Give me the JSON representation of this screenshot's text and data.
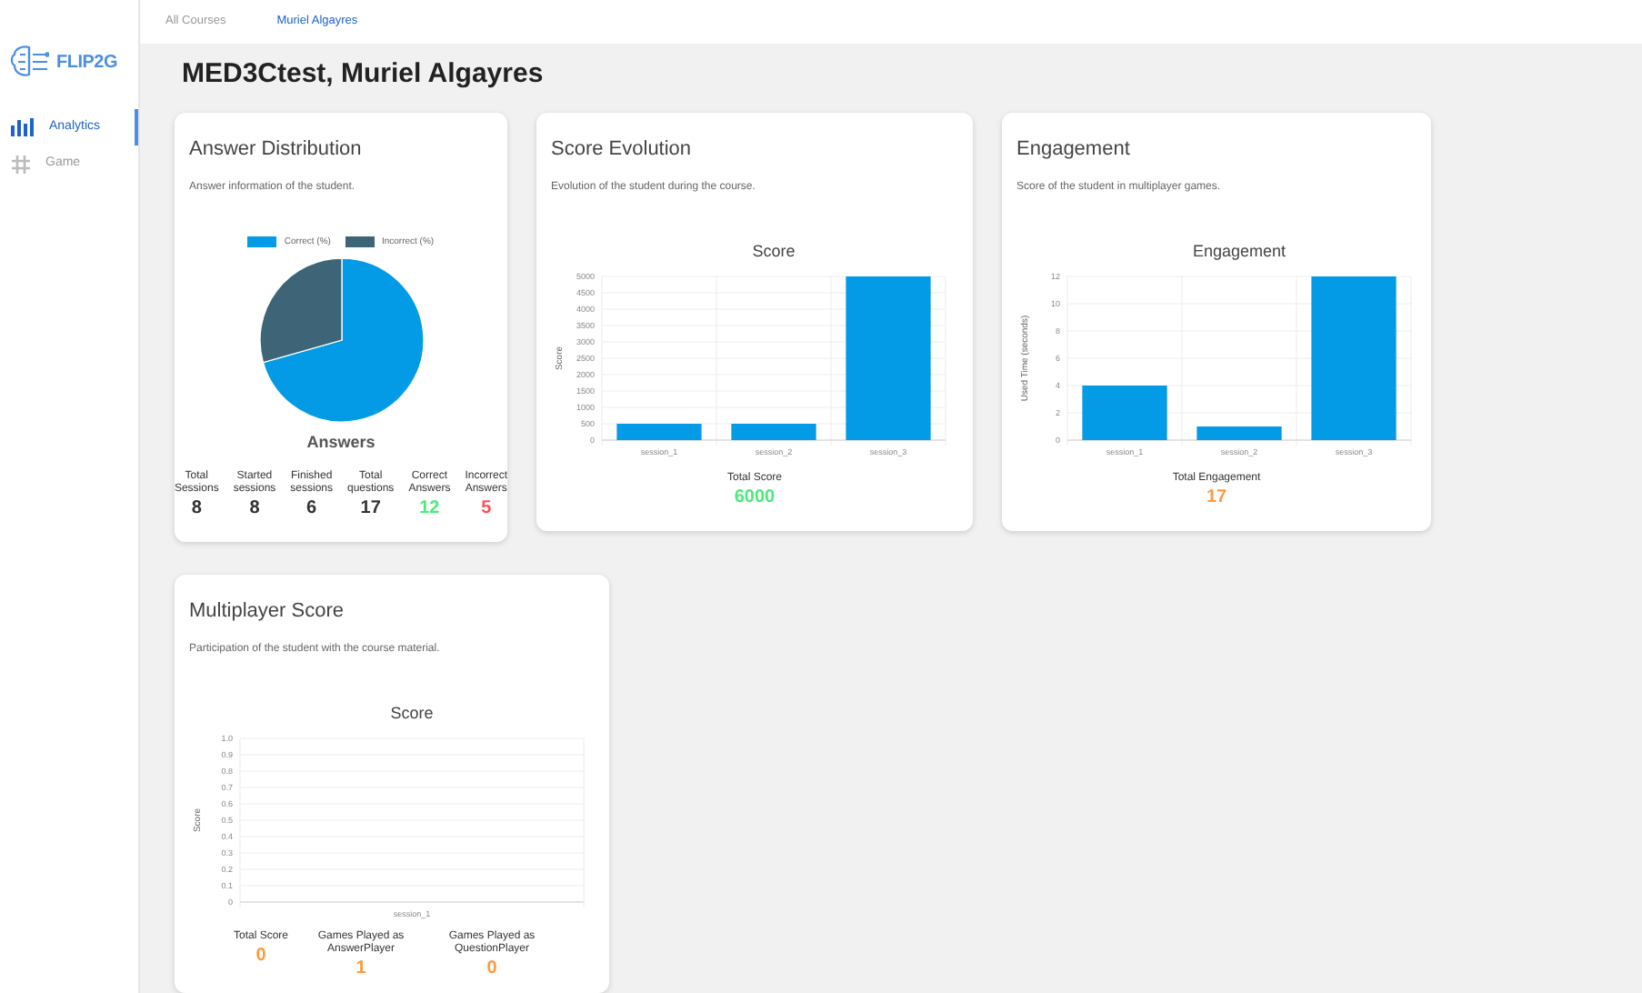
{
  "sidebar": {
    "logo": "FLIP2G",
    "items": [
      {
        "label": "Analytics",
        "kind": "analytics",
        "selected": true
      },
      {
        "label": "Game",
        "kind": "game",
        "selected": false
      }
    ]
  },
  "breadcrumbs": [
    {
      "label": "All Courses",
      "selected": false
    },
    {
      "label": "Muriel Algayres",
      "selected": true
    }
  ],
  "page_title": "MED3Ctest, Muriel Algayres",
  "cards": [
    {
      "title": "Answer Distribution",
      "subtitle": "Answer information of the student.",
      "chart_data": {
        "type": "pie",
        "title": "Answers",
        "categories": [
          "Correct (%)",
          "Incorrect (%)"
        ],
        "values": [
          70.59,
          29.41
        ],
        "colors": [
          "#039be5",
          "#3d6577"
        ],
        "legend": "top"
      },
      "stats": [
        {
          "label": "Total Sessions",
          "value": "8",
          "color": "#333333"
        },
        {
          "label": "Started sessions",
          "value": "8",
          "color": "#333333"
        },
        {
          "label": "Finished sessions",
          "value": "6",
          "color": "#333333"
        },
        {
          "label": "Total questions",
          "value": "17",
          "color": "#333333"
        },
        {
          "label": "Correct Answers",
          "value": "12",
          "color": "#4cea7c"
        },
        {
          "label": "Incorrect Answers",
          "value": "5",
          "color": "#ff5252"
        }
      ]
    },
    {
      "title": "Score Evolution",
      "subtitle": "Evolution of the student during the course.",
      "chart_data": {
        "type": "bar",
        "title": "Score",
        "ylabel": "Score",
        "categories": [
          "session_1",
          "session_2",
          "session_3"
        ],
        "values": [
          500,
          500,
          5000
        ],
        "color": "#039be5",
        "grid": true,
        "ylim": [
          0,
          5000
        ],
        "yticks": [
          0,
          500,
          1000,
          1500,
          2000,
          2500,
          3000,
          3500,
          4000,
          4500,
          5000
        ]
      },
      "stats": [
        {
          "label": "Total Score",
          "value": "6000",
          "color": "#4cea7c"
        }
      ]
    },
    {
      "title": "Engagement",
      "subtitle": "Score of the student in multiplayer games.",
      "chart_data": {
        "type": "bar",
        "title": "Engagement",
        "ylabel": "Used Time (seconds)",
        "categories": [
          "session_1",
          "session_2",
          "session_3"
        ],
        "values": [
          4,
          1,
          12
        ],
        "color": "#039be5",
        "grid": true,
        "ylim": [
          0,
          12
        ],
        "yticks": [
          0,
          2,
          4,
          6,
          8,
          10,
          12
        ]
      },
      "stats": [
        {
          "label": "Total Engagement",
          "value": "17",
          "color": "#ff9a3c"
        }
      ]
    },
    {
      "title": "Multiplayer Score",
      "subtitle": "Participation of the student with the course material.",
      "chart_data": {
        "type": "bar",
        "title": "Score",
        "ylabel": "Score",
        "categories": [
          "session_1"
        ],
        "values": [
          0
        ],
        "grid": true,
        "ylim": [
          0,
          1
        ],
        "yticks": [
          0,
          {
            "value": 0.1,
            "label": "0.1"
          },
          {
            "value": 0.2,
            "label": "0.2"
          },
          {
            "value": 0.3,
            "label": "0.3"
          },
          {
            "value": 0.4,
            "label": "0.4"
          },
          {
            "value": 0.5,
            "label": "0.5"
          },
          {
            "value": 0.6,
            "label": "0.6"
          },
          {
            "value": 0.7,
            "label": "0.7"
          },
          {
            "value": 0.8,
            "label": "0.8"
          },
          {
            "value": 0.9,
            "label": "0.9"
          },
          {
            "value": 1,
            "label": "1.0"
          }
        ]
      },
      "stats": [
        {
          "label": "Total Score",
          "value": "0",
          "color": "#ff9a3c"
        },
        {
          "label": "Games Played as AnswerPlayer",
          "value": "1",
          "color": "#ff9a3c"
        },
        {
          "label": "Games Played as QuestionPlayer",
          "value": "0",
          "color": "#ff9a3c"
        }
      ]
    }
  ]
}
